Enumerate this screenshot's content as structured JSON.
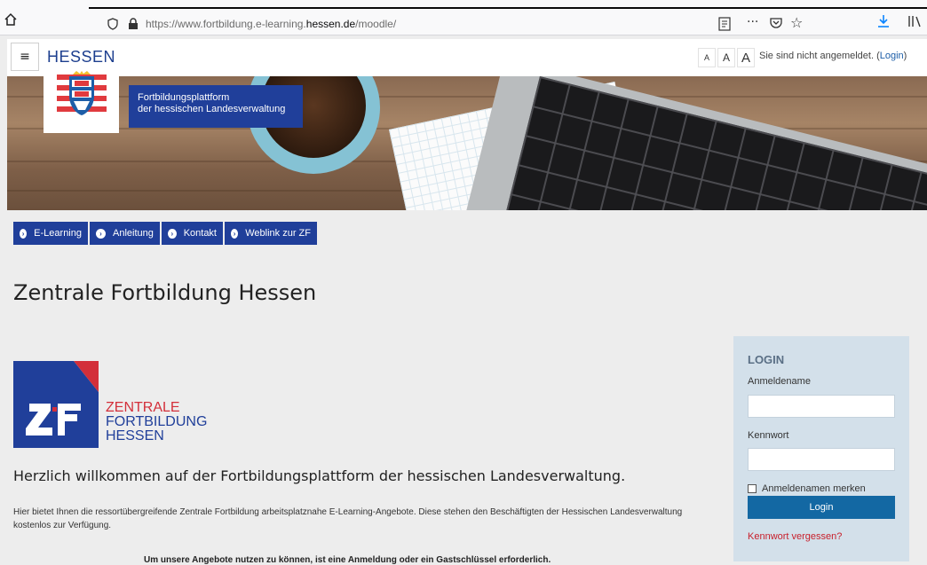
{
  "browser": {
    "url_prefix": "https://www.fortbildung.e-learning.",
    "url_domain": "hessen.de",
    "url_suffix": "/moodle/"
  },
  "header": {
    "menu_icon": "≡",
    "font_small": "A",
    "font_medium": "A",
    "font_large": "A",
    "login_status": "Sie sind nicht angemeldet. (",
    "login_link": "Login",
    "login_close": ")"
  },
  "banner": {
    "logo_text": "HESSEN",
    "platform_line1": "Fortbildungsplattform",
    "platform_line2": "der hessischen Landesverwaltung"
  },
  "nav": {
    "items": [
      {
        "label": "E-Learning"
      },
      {
        "label": "Anleitung"
      },
      {
        "label": "Kontakt"
      },
      {
        "label": "Weblink zur ZF"
      }
    ]
  },
  "main": {
    "title": "Zentrale Fortbildung Hessen",
    "zf_line1": "ZENTRALE",
    "zf_line2": "FORTBILDUNG",
    "zf_line3": "HESSEN",
    "welcome": "Herzlich willkommen auf der Fortbildungsplattform der hessischen Landesverwaltung.",
    "intro": "Hier bietet Ihnen die ressortübergreifende Zentrale Fortbildung arbeitsplatznahe E-Learning-Angebote. Diese stehen den Beschäftigten der Hessischen Landesverwaltung kostenlos zur Verfügung.",
    "cutoff": "Um unsere Angebote nutzen zu können, ist eine Anmeldung oder ein Gastschlüssel erforderlich."
  },
  "login": {
    "title": "LOGIN",
    "username_label": "Anmeldename",
    "username_value": "",
    "password_label": "Kennwort",
    "password_value": "",
    "remember_label": "Anmeldenamen merken",
    "button": "Login",
    "forgot": "Kennwort vergessen?"
  },
  "colors": {
    "brand_blue": "#203f9a",
    "login_button": "#1368a3",
    "link_red": "#c8202c",
    "panel_bg": "#d3e0ea"
  }
}
